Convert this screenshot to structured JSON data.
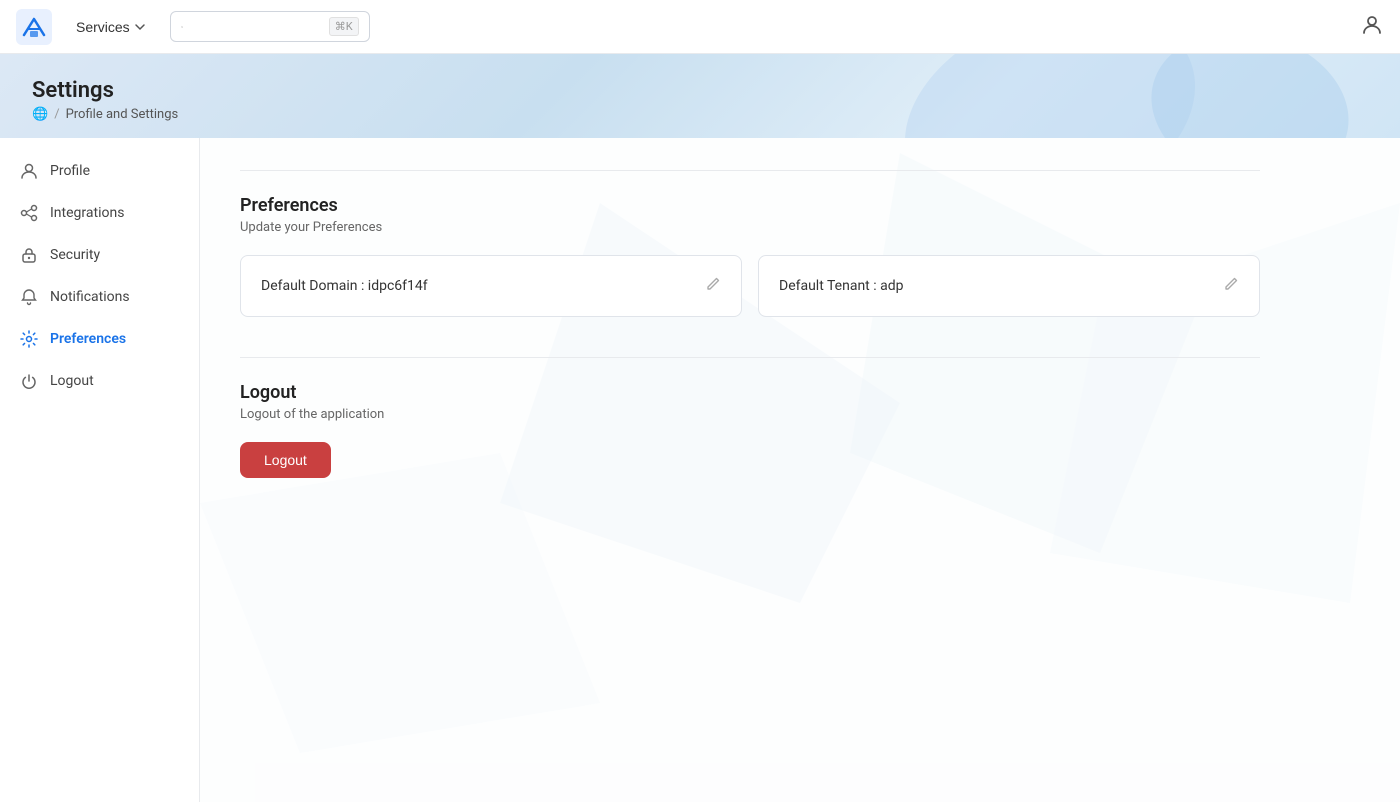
{
  "topnav": {
    "services_label": "Services",
    "search_placeholder": "",
    "search_shortcut": "⌘K",
    "user_icon_label": "user-account-icon"
  },
  "page": {
    "title": "Settings",
    "breadcrumb_home": "🌐",
    "breadcrumb_sep": "/",
    "breadcrumb_current": "Profile and Settings"
  },
  "sidebar": {
    "items": [
      {
        "id": "profile",
        "label": "Profile",
        "icon": "person-icon"
      },
      {
        "id": "integrations",
        "label": "Integrations",
        "icon": "integrations-icon"
      },
      {
        "id": "security",
        "label": "Security",
        "icon": "lock-icon"
      },
      {
        "id": "notifications",
        "label": "Notifications",
        "icon": "bell-icon"
      },
      {
        "id": "preferences",
        "label": "Preferences",
        "icon": "gear-icon",
        "active": true
      },
      {
        "id": "logout",
        "label": "Logout",
        "icon": "power-icon"
      }
    ]
  },
  "main": {
    "preferences_section": {
      "title": "Preferences",
      "description": "Update your Preferences",
      "domain_label": "Default Domain : idpc6f14f",
      "tenant_label": "Default Tenant : adp"
    },
    "logout_section": {
      "title": "Logout",
      "description": "Logout of the application",
      "button_label": "Logout"
    }
  }
}
